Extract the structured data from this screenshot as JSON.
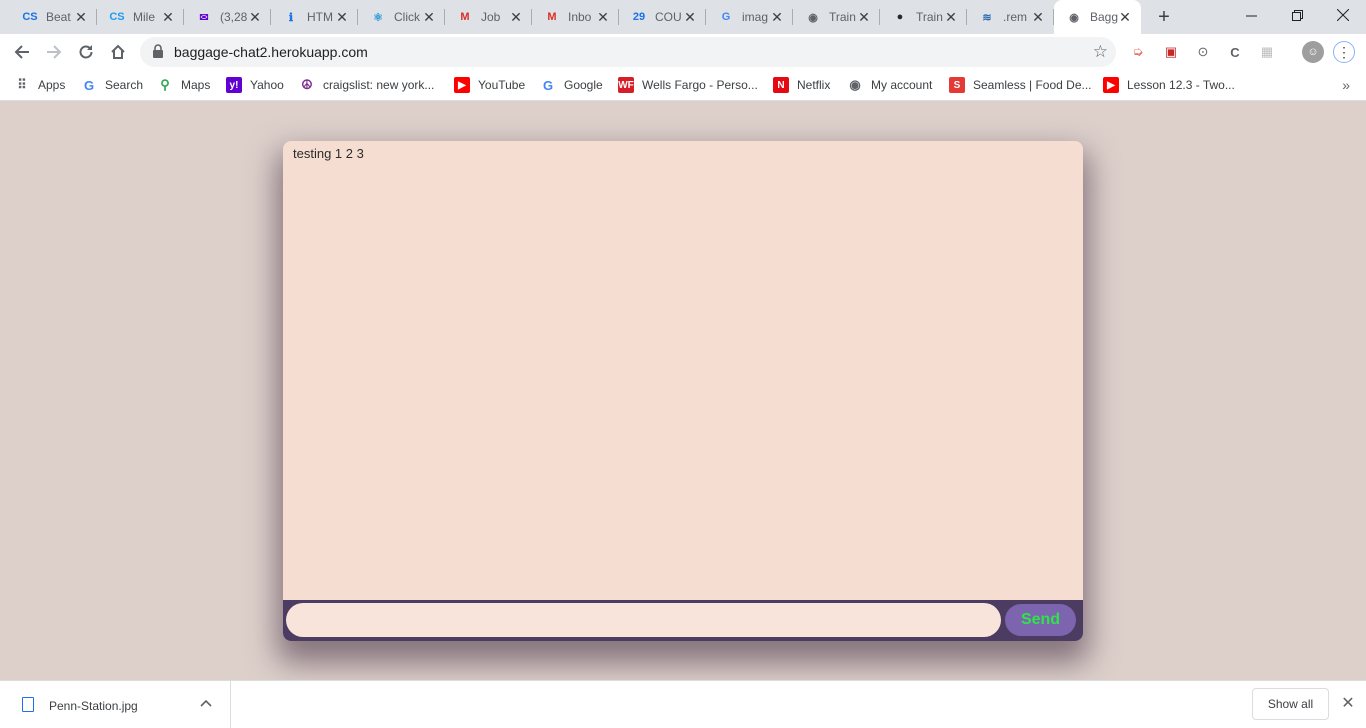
{
  "browser": {
    "tabs": [
      {
        "title": "Beat",
        "icon": "cs-logo-icon",
        "color": "#1a73e8",
        "glyph": "CS"
      },
      {
        "title": "Mile",
        "icon": "cs-logo-icon",
        "color": "#1a9ef0",
        "glyph": "CS"
      },
      {
        "title": "(3,28",
        "icon": "yahoo-mail-icon",
        "color": "#6001d2",
        "glyph": "✉"
      },
      {
        "title": "HTM",
        "icon": "tip-icon",
        "color": "#1a73e8",
        "glyph": "ℹ"
      },
      {
        "title": "Click",
        "icon": "react-icon",
        "color": "#2f9bd6",
        "glyph": "⚛"
      },
      {
        "title": "Job",
        "icon": "gmail-icon",
        "color": "#d93025",
        "glyph": "M"
      },
      {
        "title": "Inbo",
        "icon": "gmail-icon",
        "color": "#d93025",
        "glyph": "M"
      },
      {
        "title": "COU",
        "icon": "calendar-icon",
        "color": "#1a73e8",
        "glyph": "29"
      },
      {
        "title": "imag",
        "icon": "google-icon",
        "color": "#4285f4",
        "glyph": "G"
      },
      {
        "title": "Train",
        "icon": "globe-icon",
        "color": "#5f6368",
        "glyph": "◉"
      },
      {
        "title": "Train",
        "icon": "github-icon",
        "color": "#24292e",
        "glyph": "●"
      },
      {
        "title": ".rem",
        "icon": "wave-icon",
        "color": "#2b6fb3",
        "glyph": "≋"
      },
      {
        "title": "Bagg",
        "icon": "globe-icon",
        "color": "#5f6368",
        "glyph": "◉",
        "active": true
      }
    ],
    "url": "baggage-chat2.herokuapp.com",
    "bookmarks": [
      {
        "label": "Apps",
        "icon": "apps-grid-icon",
        "color": "#5f6368",
        "glyph": "⠿"
      },
      {
        "label": "Search",
        "icon": "google-icon",
        "color": "#4285f4",
        "glyph": "G"
      },
      {
        "label": "Maps",
        "icon": "maps-pin-icon",
        "color": "#34a853",
        "glyph": "⚲"
      },
      {
        "label": "Yahoo",
        "icon": "yahoo-icon",
        "color": "#6001d2",
        "glyph": "y!"
      },
      {
        "label": "craigslist: new york...",
        "icon": "peace-icon",
        "color": "#7b2d91",
        "glyph": "☮"
      },
      {
        "label": "YouTube",
        "icon": "youtube-icon",
        "color": "#ff0000",
        "glyph": "▶"
      },
      {
        "label": "Google",
        "icon": "google-icon",
        "color": "#4285f4",
        "glyph": "G"
      },
      {
        "label": "Wells Fargo - Perso...",
        "icon": "wells-fargo-icon",
        "color": "#d71e28",
        "glyph": "WF"
      },
      {
        "label": "Netflix",
        "icon": "netflix-icon",
        "color": "#e50914",
        "glyph": "N"
      },
      {
        "label": "My account",
        "icon": "globe-icon",
        "color": "#5f6368",
        "glyph": "◉"
      },
      {
        "label": "Seamless | Food De...",
        "icon": "seamless-icon",
        "color": "#e53935",
        "glyph": "S"
      },
      {
        "label": "Lesson 12.3 - Two...",
        "icon": "youtube-icon",
        "color": "#ff0000",
        "glyph": "▶"
      }
    ]
  },
  "chat": {
    "messages": [
      "testing 1 2 3"
    ],
    "input_value": "",
    "send_label": "Send"
  },
  "downloads": {
    "file_name": "Penn-Station.jpg",
    "show_all_label": "Show all"
  }
}
